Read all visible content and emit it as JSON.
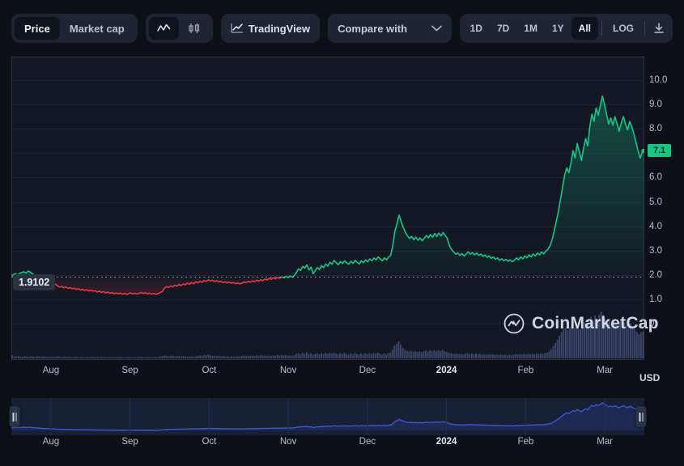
{
  "toolbar": {
    "metric_tabs": [
      {
        "label": "Price",
        "active": true,
        "name": "tab-price"
      },
      {
        "label": "Market cap",
        "active": false,
        "name": "tab-market-cap"
      }
    ],
    "chart_type_buttons": [
      {
        "icon": "line-chart-icon",
        "active": true,
        "name": "chart-type-line"
      },
      {
        "icon": "candlestick-chart-icon",
        "active": false,
        "name": "chart-type-candles"
      }
    ],
    "tradingview": {
      "label": "TradingView",
      "icon": "tradingview-icon"
    },
    "compare": {
      "label": "Compare with",
      "icon": "chevron-down-icon"
    },
    "ranges": [
      {
        "label": "1D",
        "active": false
      },
      {
        "label": "7D",
        "active": false
      },
      {
        "label": "1M",
        "active": false
      },
      {
        "label": "1Y",
        "active": false
      },
      {
        "label": "All",
        "active": true
      }
    ],
    "log_label": "LOG",
    "download_icon": "download-icon"
  },
  "chart_data": {
    "type": "line",
    "title": "",
    "xlabel": "",
    "ylabel": "USD",
    "currency": "USD",
    "ylim": [
      0,
      10.5
    ],
    "yticks": [
      0,
      1.0,
      2.0,
      3.0,
      4.0,
      5.0,
      6.0,
      7.0,
      8.0,
      9.0,
      10.0
    ],
    "ytick_labels": [
      "0",
      "1.0",
      "2.0",
      "3.0",
      "4.0",
      "5.0",
      "6.0",
      "7.0",
      "8.0",
      "9.0",
      "10.0"
    ],
    "grid": true,
    "legend": "none",
    "xtick_labels": [
      "Aug",
      "Sep",
      "Oct",
      "Nov",
      "Dec",
      "2024",
      "Feb",
      "Mar"
    ],
    "xtick_bold": [
      "2024"
    ],
    "current_price_label": "7.1",
    "current_price": 7.1,
    "anchor_price_label": "1.9102",
    "anchor_price": 1.9102,
    "up_color": "#16c784",
    "down_color": "#ea3943",
    "volume_color": "#5a6a9e",
    "series": [
      {
        "name": "Price (USD)",
        "values": [
          1.93,
          2.02,
          2.05,
          1.98,
          2.07,
          2.1,
          2.13,
          2.08,
          2.16,
          2.12,
          2.05,
          1.98,
          1.96,
          1.91,
          1.84,
          1.78,
          1.73,
          1.76,
          1.7,
          1.66,
          1.68,
          1.62,
          1.55,
          1.5,
          1.53,
          1.47,
          1.5,
          1.45,
          1.48,
          1.43,
          1.45,
          1.4,
          1.43,
          1.38,
          1.41,
          1.36,
          1.39,
          1.34,
          1.37,
          1.33,
          1.35,
          1.3,
          1.33,
          1.28,
          1.31,
          1.26,
          1.29,
          1.24,
          1.27,
          1.23,
          1.26,
          1.22,
          1.25,
          1.21,
          1.24,
          1.2,
          1.23,
          1.26,
          1.22,
          1.25,
          1.21,
          1.24,
          1.28,
          1.23,
          1.27,
          1.22,
          1.25,
          1.21,
          1.24,
          1.2,
          1.23,
          1.27,
          1.32,
          1.45,
          1.52,
          1.48,
          1.55,
          1.5,
          1.58,
          1.54,
          1.61,
          1.56,
          1.63,
          1.59,
          1.66,
          1.62,
          1.69,
          1.64,
          1.72,
          1.67,
          1.74,
          1.7,
          1.77,
          1.73,
          1.8,
          1.75,
          1.78,
          1.73,
          1.76,
          1.71,
          1.74,
          1.69,
          1.72,
          1.67,
          1.7,
          1.66,
          1.69,
          1.64,
          1.67,
          1.63,
          1.66,
          1.71,
          1.68,
          1.74,
          1.7,
          1.76,
          1.72,
          1.78,
          1.74,
          1.8,
          1.76,
          1.83,
          1.79,
          1.86,
          1.82,
          1.88,
          1.84,
          1.9,
          1.86,
          1.92,
          1.88,
          1.94,
          1.89,
          1.95,
          1.91,
          1.97,
          2.1,
          2.25,
          2.18,
          2.35,
          2.28,
          2.42,
          2.2,
          2.32,
          2.05,
          2.18,
          2.3,
          2.22,
          2.38,
          2.3,
          2.45,
          2.36,
          2.52,
          2.44,
          2.6,
          2.5,
          2.42,
          2.55,
          2.47,
          2.58,
          2.5,
          2.44,
          2.56,
          2.48,
          2.6,
          2.52,
          2.45,
          2.58,
          2.5,
          2.62,
          2.54,
          2.66,
          2.58,
          2.7,
          2.62,
          2.74,
          2.66,
          2.58,
          2.7,
          2.62,
          2.74,
          2.8,
          3.2,
          3.8,
          4.1,
          4.45,
          4.2,
          3.95,
          3.75,
          3.6,
          3.5,
          3.58,
          3.45,
          3.55,
          3.42,
          3.52,
          3.4,
          3.5,
          3.62,
          3.52,
          3.66,
          3.55,
          3.7,
          3.58,
          3.72,
          3.6,
          3.74,
          3.62,
          3.5,
          3.2,
          3.05,
          2.95,
          2.85,
          2.9,
          2.8,
          2.88,
          2.78,
          2.86,
          2.95,
          2.85,
          2.92,
          2.82,
          2.9,
          2.8,
          2.86,
          2.76,
          2.82,
          2.72,
          2.78,
          2.68,
          2.74,
          2.64,
          2.7,
          2.6,
          2.66,
          2.58,
          2.64,
          2.56,
          2.62,
          2.54,
          2.6,
          2.7,
          2.62,
          2.74,
          2.66,
          2.78,
          2.7,
          2.82,
          2.74,
          2.86,
          2.78,
          2.9,
          2.82,
          2.94,
          2.86,
          2.98,
          3.05,
          3.2,
          3.45,
          3.8,
          4.2,
          4.6,
          5.1,
          5.6,
          6.1,
          6.4,
          6.2,
          6.6,
          7.1,
          6.8,
          7.4,
          7.05,
          6.7,
          7.2,
          7.6,
          7.3,
          8.1,
          8.6,
          8.3,
          8.85,
          8.55,
          8.95,
          9.35,
          9.0,
          8.6,
          8.2,
          8.45,
          8.15,
          8.5,
          8.2,
          7.9,
          8.25,
          8.5,
          8.2,
          7.95,
          8.3,
          8.1,
          7.8,
          7.45,
          7.1,
          6.8,
          7.05,
          7.1
        ]
      }
    ],
    "volume": {
      "name": "Volume",
      "values": [
        14,
        10,
        9,
        12,
        9,
        8,
        11,
        8,
        7,
        9,
        8,
        7,
        10,
        8,
        7,
        9,
        7,
        6,
        8,
        7,
        6,
        8,
        9,
        7,
        6,
        8,
        6,
        7,
        6,
        5,
        7,
        6,
        5,
        7,
        6,
        5,
        6,
        5,
        7,
        6,
        5,
        6,
        5,
        7,
        6,
        5,
        6,
        7,
        5,
        6,
        5,
        7,
        6,
        5,
        6,
        5,
        7,
        6,
        5,
        6,
        5,
        6,
        7,
        6,
        5,
        7,
        6,
        5,
        6,
        5,
        7,
        9,
        11,
        14,
        12,
        10,
        13,
        11,
        9,
        12,
        10,
        9,
        11,
        9,
        8,
        10,
        9,
        8,
        10,
        12,
        14,
        11,
        16,
        13,
        18,
        14,
        11,
        13,
        10,
        12,
        9,
        11,
        9,
        10,
        8,
        10,
        9,
        8,
        10,
        9,
        11,
        13,
        10,
        12,
        10,
        13,
        11,
        14,
        12,
        15,
        12,
        14,
        11,
        13,
        11,
        14,
        12,
        15,
        13,
        16,
        13,
        15,
        12,
        14,
        12,
        15,
        20,
        24,
        19,
        26,
        21,
        28,
        20,
        23,
        17,
        20,
        23,
        19,
        24,
        20,
        25,
        21,
        26,
        22,
        27,
        22,
        19,
        24,
        20,
        25,
        20,
        17,
        23,
        19,
        24,
        20,
        17,
        22,
        18,
        23,
        19,
        24,
        20,
        25,
        21,
        26,
        22,
        18,
        23,
        19,
        24,
        26,
        40,
        58,
        66,
        78,
        62,
        48,
        40,
        35,
        32,
        35,
        30,
        34,
        29,
        33,
        28,
        32,
        36,
        31,
        37,
        32,
        38,
        32,
        38,
        33,
        39,
        33,
        30,
        26,
        24,
        22,
        20,
        22,
        19,
        21,
        18,
        21,
        24,
        20,
        23,
        19,
        22,
        18,
        21,
        17,
        20,
        16,
        19,
        16,
        19,
        15,
        18,
        15,
        18,
        15,
        18,
        14,
        17,
        14,
        17,
        20,
        17,
        20,
        17,
        21,
        18,
        21,
        18,
        22,
        19,
        23,
        19,
        23,
        20,
        24,
        26,
        32,
        42,
        56,
        70,
        86,
        104,
        120,
        134,
        140,
        128,
        142,
        156,
        140,
        162,
        146,
        132,
        150,
        164,
        150,
        178,
        190,
        176,
        196,
        182,
        200,
        214,
        198,
        180,
        166,
        176,
        162,
        178,
        164,
        150,
        168,
        178,
        164,
        152,
        170,
        160,
        146,
        132,
        120,
        110,
        118,
        122
      ]
    },
    "navigator": {
      "color": "#3b5bdb",
      "xtick_labels": [
        "Aug",
        "Sep",
        "Oct",
        "Nov",
        "Dec",
        "2024",
        "Feb",
        "Mar"
      ],
      "selection_start": 0,
      "selection_end": 100
    }
  },
  "watermark": {
    "text": "CoinMarketCap",
    "icon": "coinmarketcap-logo-icon"
  }
}
